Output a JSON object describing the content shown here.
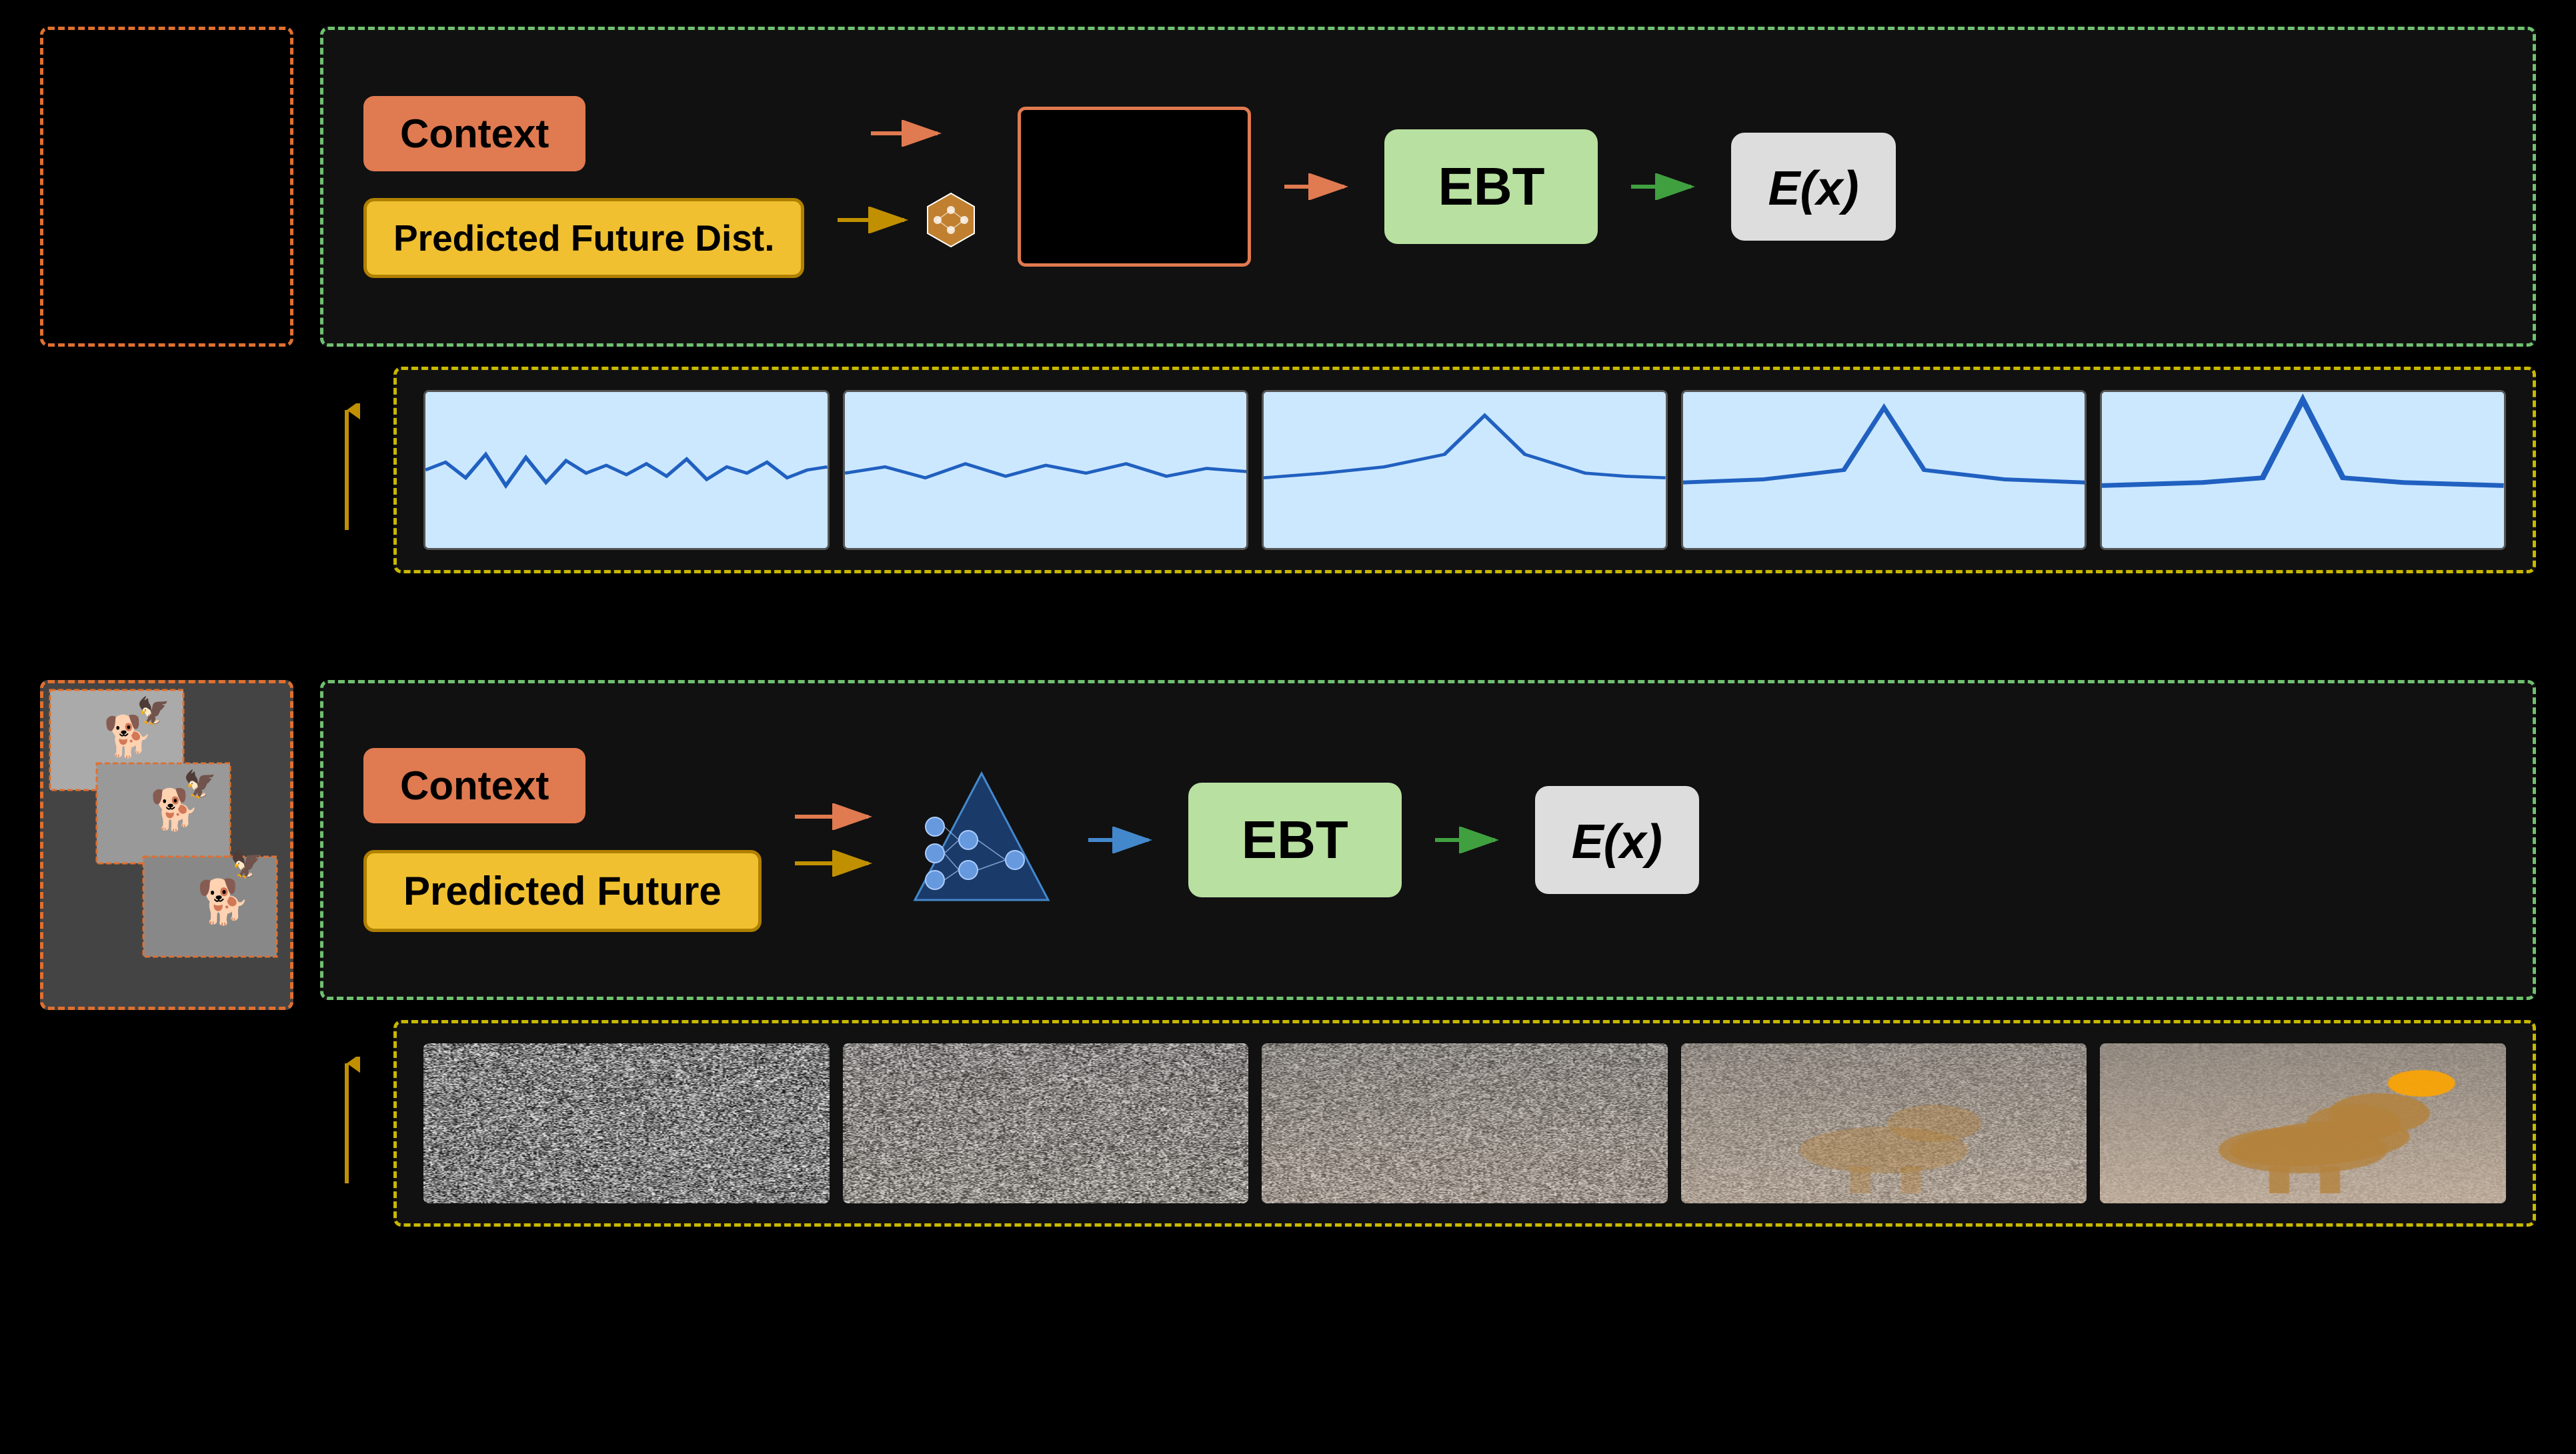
{
  "background_color": "#000000",
  "top_section": {
    "left_box": {
      "border_color": "#e07030",
      "content": ""
    },
    "main_flow": {
      "border_color": "#70c070",
      "context_label": "Context",
      "context_color": "#e07a50",
      "pred_future_dist_label": "Predicted Future Dist.",
      "pred_future_dist_color": "#f0c030",
      "ebt_label": "EBT",
      "ebt_color": "#b8e0a0",
      "ex_label": "E(x)",
      "ex_color": "#cccccc"
    },
    "charts_area": {
      "border_color": "#c8b800",
      "items": [
        {
          "id": "chart1",
          "type": "waveform",
          "peaked": false
        },
        {
          "id": "chart2",
          "type": "waveform",
          "peaked": false
        },
        {
          "id": "chart3",
          "type": "waveform",
          "peaked": true
        },
        {
          "id": "chart4",
          "type": "waveform",
          "peaked": true
        },
        {
          "id": "chart5",
          "type": "waveform",
          "peaked": true
        }
      ]
    }
  },
  "bottom_section": {
    "context_label": "Context",
    "context_color": "#e07a50",
    "pred_future_label": "Predicted Future",
    "pred_future_color": "#f0c030",
    "ebt_label": "EBT",
    "ebt_color": "#b8e0a0",
    "ex_label": "E(x)",
    "ex_color": "#cccccc",
    "frames": [
      {
        "id": "f1",
        "clarity": 0
      },
      {
        "id": "f2",
        "clarity": 1
      },
      {
        "id": "f3",
        "clarity": 2
      },
      {
        "id": "f4",
        "clarity": 3
      },
      {
        "id": "f5",
        "clarity": 4
      }
    ]
  },
  "arrows": {
    "orange_right": "→",
    "yellow_right": "→",
    "green_right": "→",
    "up_yellow": "↑"
  }
}
